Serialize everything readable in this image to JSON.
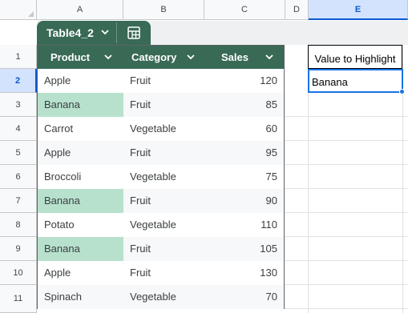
{
  "columns": [
    "A",
    "B",
    "C",
    "D",
    "E"
  ],
  "rows": [
    "1",
    "2",
    "3",
    "4",
    "5",
    "6",
    "7",
    "8",
    "9",
    "10",
    "11"
  ],
  "table_tab": {
    "name": "Table4_2",
    "chevron_icon": "chevron-down-icon",
    "view_icon": "table-grid-icon"
  },
  "table": {
    "headers": [
      "Product",
      "Category",
      "Sales"
    ],
    "rows": [
      {
        "product": "Apple",
        "category": "Fruit",
        "sales": "120",
        "highlight": false
      },
      {
        "product": "Banana",
        "category": "Fruit",
        "sales": "85",
        "highlight": true
      },
      {
        "product": "Carrot",
        "category": "Vegetable",
        "sales": "60",
        "highlight": false
      },
      {
        "product": "Apple",
        "category": "Fruit",
        "sales": "95",
        "highlight": false
      },
      {
        "product": "Broccoli",
        "category": "Vegetable",
        "sales": "75",
        "highlight": false
      },
      {
        "product": "Banana",
        "category": "Fruit",
        "sales": "90",
        "highlight": true
      },
      {
        "product": "Potato",
        "category": "Vegetable",
        "sales": "110",
        "highlight": false
      },
      {
        "product": "Banana",
        "category": "Fruit",
        "sales": "105",
        "highlight": true
      },
      {
        "product": "Apple",
        "category": "Fruit",
        "sales": "130",
        "highlight": false
      },
      {
        "product": "Spinach",
        "category": "Vegetable",
        "sales": "70",
        "highlight": false
      }
    ]
  },
  "highlight_panel": {
    "label": "Value to Highlight",
    "value": "Banana"
  },
  "selection": {
    "column": "E",
    "row": "2"
  },
  "colors": {
    "table_header": "#386a56",
    "highlight": "#b7e1cd",
    "selection": "#1a73e8"
  }
}
